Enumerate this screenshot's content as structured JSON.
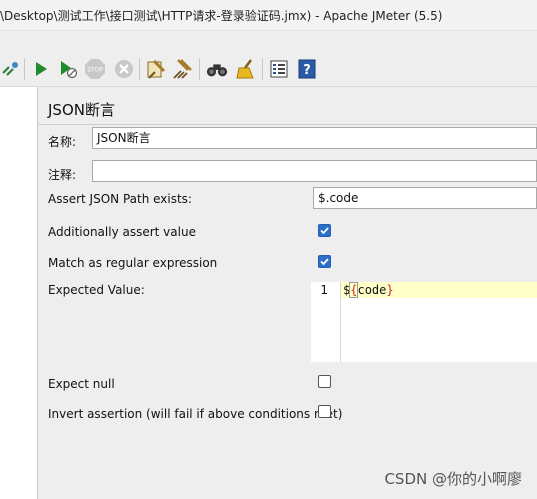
{
  "window": {
    "title": "\\Desktop\\测试工作\\接口测试\\HTTP请求-登录验证码.jmx) - Apache JMeter (5.5)"
  },
  "toolbar": {
    "buttons": [
      {
        "name": "start-icon",
        "color": "#1f8c2f"
      },
      {
        "name": "start-no-pauses-icon",
        "color": "#1f8c2f"
      },
      {
        "name": "stop-icon",
        "color": "#bdbdbd"
      },
      {
        "name": "shutdown-icon",
        "color": "#bdbdbd"
      },
      {
        "name": "clear-icon",
        "color": "#a67c2c"
      },
      {
        "name": "clear-all-icon",
        "color": "#a67c2c"
      },
      {
        "name": "search-binoculars-icon",
        "color": "#333333"
      },
      {
        "name": "reset-search-broom-icon",
        "color": "#d8a21b"
      },
      {
        "name": "function-helper-list-icon",
        "color": "#2b4c8a"
      },
      {
        "name": "help-icon",
        "color": "#2b5aa6"
      }
    ]
  },
  "panel": {
    "title": "JSON断言",
    "name_label": "名称:",
    "name_value": "JSON断言",
    "comment_label": "注释:",
    "comment_value": "",
    "assert_path_label": "Assert JSON Path exists:",
    "assert_path_value": "$.code",
    "additionally_assert_label": "Additionally assert value",
    "additionally_assert_checked": true,
    "match_regex_label": "Match as regular expression",
    "match_regex_checked": true,
    "expected_value_label": "Expected Value:",
    "expected_value_editor": {
      "line_number": "1",
      "text_dollar": "$",
      "text_open_brace": "{",
      "text_var": "code",
      "text_close_brace": "}"
    },
    "expect_null_label": "Expect null",
    "expect_null_checked": false,
    "invert_label": "Invert assertion (will fail if above conditions met)",
    "invert_checked": false
  },
  "watermark": "CSDN @你的小啊廖",
  "colors": {
    "checkbox_checked": "#2a6fc9",
    "current_line_highlight": "#ffffc8"
  }
}
